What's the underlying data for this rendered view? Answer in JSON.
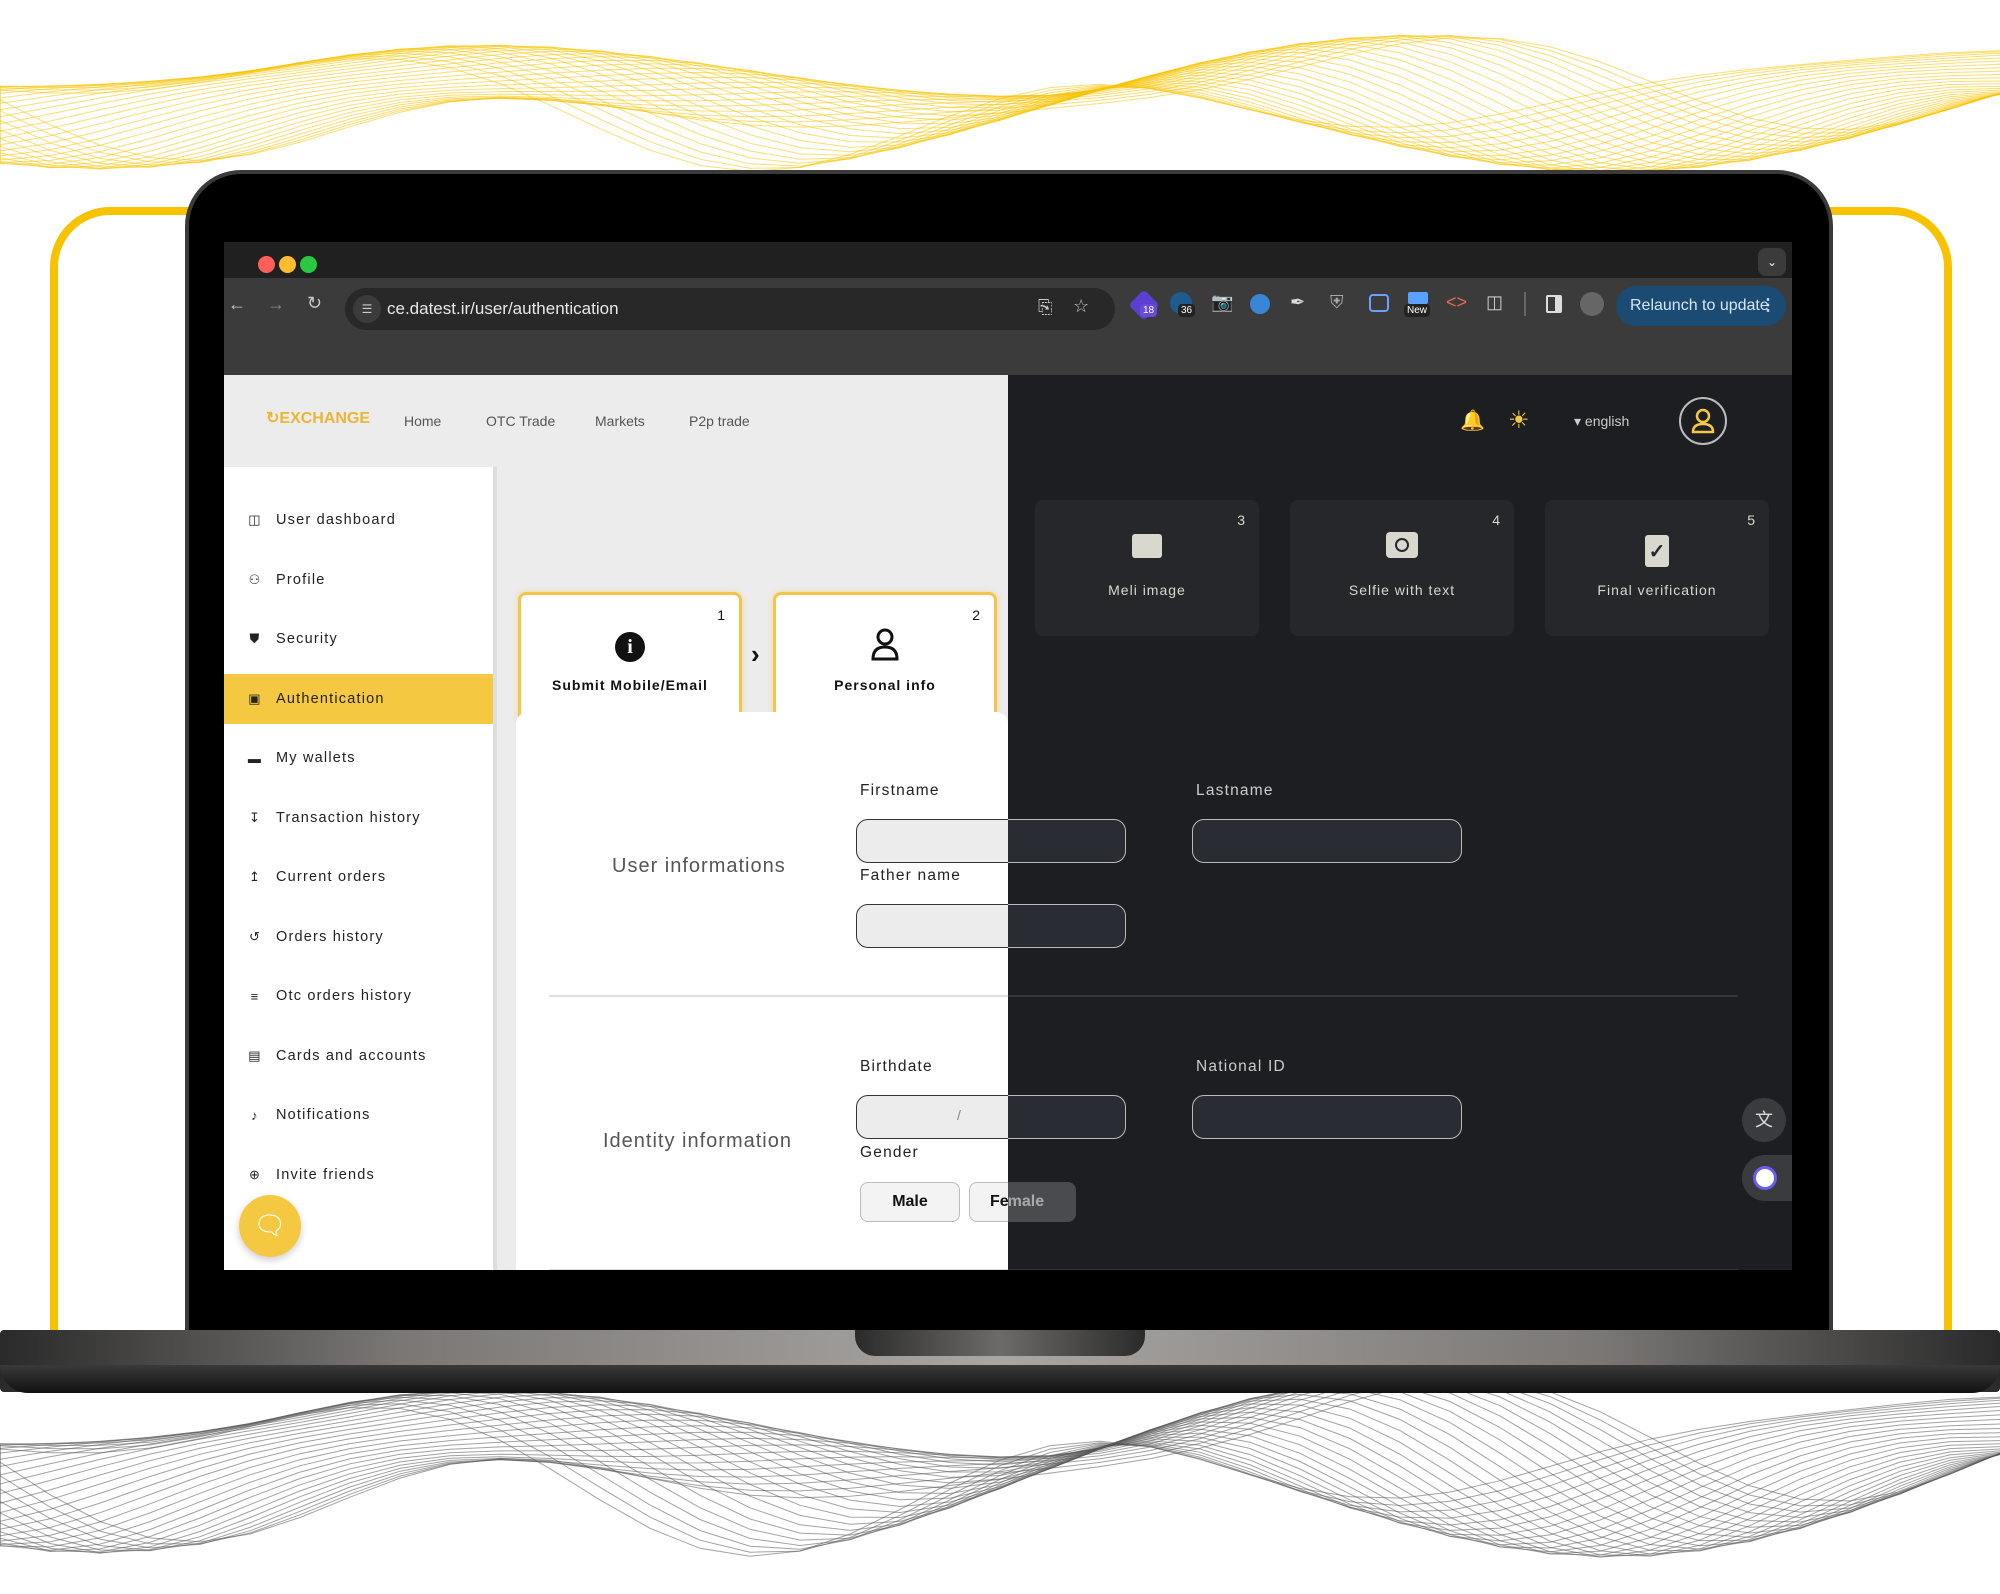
{
  "browser": {
    "url": "ce.datest.ir/user/authentication",
    "extension_badges": [
      "18",
      "36",
      "New"
    ],
    "relaunch_label": "Relaunch to update",
    "window_controls": [
      "close",
      "minimize",
      "fullscreen"
    ]
  },
  "header": {
    "logo": "EXCHANGE",
    "nav": [
      "Home",
      "OTC Trade",
      "Markets",
      "P2p trade"
    ],
    "language": "english"
  },
  "sidebar": {
    "items": [
      {
        "label": "User dashboard",
        "icon": "dashboard-icon"
      },
      {
        "label": "Profile",
        "icon": "user-icon"
      },
      {
        "label": "Security",
        "icon": "shield-icon"
      },
      {
        "label": "Authentication",
        "icon": "id-badge-icon",
        "active": true
      },
      {
        "label": "My wallets",
        "icon": "wallet-icon"
      },
      {
        "label": "Transaction history",
        "icon": "sort-down-icon"
      },
      {
        "label": "Current orders",
        "icon": "sort-up-icon"
      },
      {
        "label": "Orders history",
        "icon": "history-icon"
      },
      {
        "label": "Otc orders history",
        "icon": "layers-icon"
      },
      {
        "label": "Cards and accounts",
        "icon": "card-icon"
      },
      {
        "label": "Notifications",
        "icon": "bell-icon"
      },
      {
        "label": "Invite friends",
        "icon": "invite-icon"
      }
    ]
  },
  "steps": [
    {
      "num": "1",
      "label": "Submit Mobile/Email",
      "icon": "info-icon",
      "state": "done"
    },
    {
      "num": "2",
      "label": "Personal info",
      "icon": "user-icon",
      "state": "current"
    },
    {
      "num": "3",
      "label": "Meli image",
      "icon": "id-card-icon",
      "state": "pending"
    },
    {
      "num": "4",
      "label": "Selfie with text",
      "icon": "camera-icon",
      "state": "pending"
    },
    {
      "num": "5",
      "label": "Final verification",
      "icon": "clipboard-check-icon",
      "state": "pending"
    }
  ],
  "form": {
    "user_section": {
      "title": "User informations",
      "firstname_label": "Firstname",
      "firstname_value": "",
      "lastname_label": "Lastname",
      "lastname_value": "",
      "fathername_label": "Father name",
      "fathername_value": ""
    },
    "identity_section": {
      "title": "Identity information",
      "birthdate_label": "Birthdate",
      "birthdate_placeholder": "/ /",
      "nationalid_label": "National ID",
      "nationalid_value": "",
      "gender_label": "Gender",
      "gender_options": [
        "Male",
        "Female"
      ]
    }
  },
  "colors": {
    "accent": "#f5c842",
    "dark_bg": "#1d1e22",
    "light_bg": "#ececec",
    "relaunch": "#1b4a72"
  }
}
